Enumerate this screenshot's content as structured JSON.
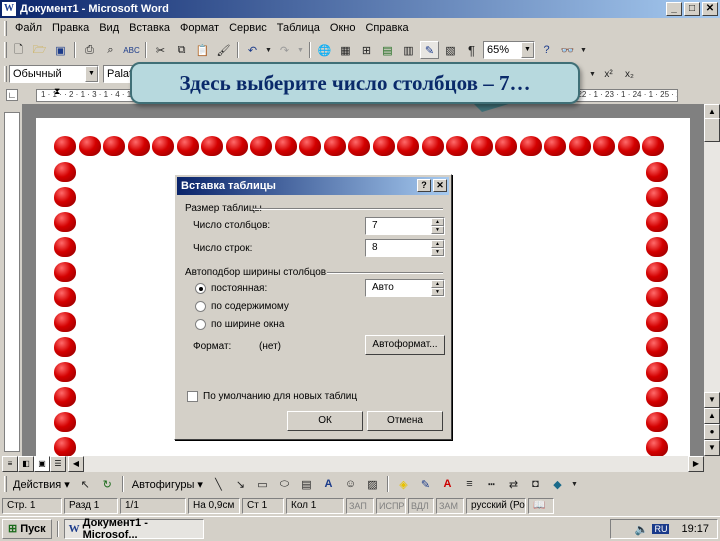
{
  "window": {
    "title": "Документ1 - Microsoft Word",
    "app_icon": "W"
  },
  "menu": [
    "Файл",
    "Правка",
    "Вид",
    "Вставка",
    "Формат",
    "Сервис",
    "Таблица",
    "Окно",
    "Справка"
  ],
  "standard_toolbar": {
    "zoom": "65%"
  },
  "format_toolbar": {
    "style": "Обычный",
    "font": "Palatin"
  },
  "callout": {
    "text": "Здесь выберите число столбцов – 7…"
  },
  "ruler": {
    "ticks": "1 · 1 · · 2 · 1 · 3 · 1 · 4 · 1 · 5 · 1 · 6 · 1 · 7 · · 8 · 1 · 9 · 1 · 10 · 1 · 11 · 1 · 12 · 1 · 13 · 1 · 14 · 1 · 15 · 1 · 16 · 1 · 17 · 1 · 18 · 1 · 19 · 1 · 20 · 1 · 21 · 1 · 22 · 1 · 23 · 1 · 24 · 1 · 25 · 1 · 26 · 1 · 27 · 1 · 28"
  },
  "dialog": {
    "title": "Вставка таблицы",
    "help_label": "?",
    "close_label": "✕",
    "size_group": "Размер таблицы",
    "columns_label": "Число столбцов:",
    "columns_value": "7",
    "rows_label": "Число строк:",
    "rows_value": "8",
    "autofit_group": "Автоподбор ширины столбцов",
    "fixed_label": "постоянная:",
    "fixed_value": "Авто",
    "content_label": "по содержимому",
    "window_label": "по ширине окна",
    "format_label": "Формат:",
    "format_value": "(нет)",
    "autoformat_button": "Автоформат...",
    "default_label": "По умолчанию для новых таблиц",
    "ok_button": "ОК",
    "cancel_button": "Отмена"
  },
  "draw_toolbar": {
    "actions": "Действия",
    "autoshapes": "Автофигуры"
  },
  "status": {
    "page": "Стр. 1",
    "section": "Разд 1",
    "pages": "1/1",
    "at": "На 0,9см",
    "line": "Ст 1",
    "col": "Кол 1",
    "rec": "ЗАП",
    "trk": "ИСПР",
    "ext": "ВДЛ",
    "ovr": "ЗАМ",
    "lang": "русский (Ро"
  },
  "taskbar": {
    "start": "Пуск",
    "task": "Документ1 - Microsof...",
    "lang": "RU",
    "clock": "19:17"
  }
}
